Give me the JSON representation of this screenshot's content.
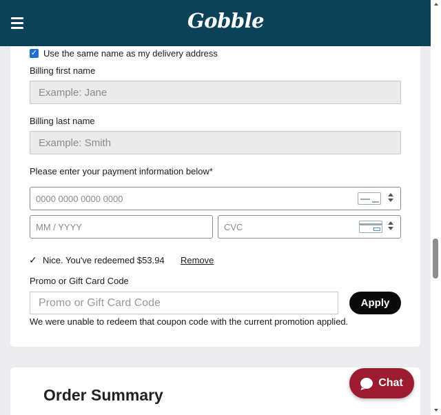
{
  "header": {
    "logo": "Gobble"
  },
  "billing": {
    "same_name_label": "Use the same name as my delivery address",
    "same_name_checked": true,
    "first_name_label": "Billing first name",
    "first_name_placeholder": "Example: Jane",
    "last_name_label": "Billing last name",
    "last_name_placeholder": "Example: Smith"
  },
  "payment": {
    "heading": "Please enter your payment information below*",
    "card_number_placeholder": "0000 0000 0000 0000",
    "expiry_placeholder": "MM / YYYY",
    "cvc_placeholder": "CVC"
  },
  "redeem": {
    "message": "Nice. You've redeemed $53.94",
    "remove_label": "Remove"
  },
  "promo": {
    "label": "Promo or Gift Card Code",
    "placeholder": "Promo or Gift Card Code",
    "apply_label": "Apply",
    "error": "We were unable to redeem that coupon code with the current promotion applied."
  },
  "summary": {
    "title": "Order Summary"
  },
  "chat": {
    "label": "Chat"
  },
  "colors": {
    "header": "#0b4159",
    "chat": "#9b1c2e",
    "apply": "#0a0a0a"
  }
}
